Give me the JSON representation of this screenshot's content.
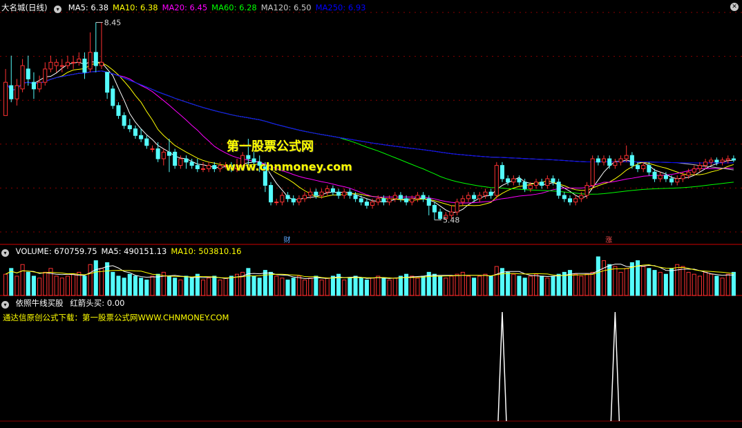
{
  "price_panel": {
    "title": "大名城(日线)",
    "indicators": [
      {
        "label": "MA5: 6.38",
        "color": "#ffffff"
      },
      {
        "label": "MA10: 6.38",
        "color": "#ffff00"
      },
      {
        "label": "MA20: 6.45",
        "color": "#ff00ff"
      },
      {
        "label": "MA60: 6.28",
        "color": "#00ff00"
      },
      {
        "label": "MA120: 6.50",
        "color": "#c8c8c8"
      },
      {
        "label": "MA250: 6.93",
        "color": "#0000ff"
      }
    ],
    "high_label": "8.45",
    "low_label": "5.48",
    "event_markers": [
      "财",
      "涨"
    ]
  },
  "volume_panel": {
    "indicators": [
      {
        "label": "VOLUME: 670759.75",
        "color": "#ffffff"
      },
      {
        "label": "MA5: 490151.13",
        "color": "#ffffff"
      },
      {
        "label": "MA10: 503810.16",
        "color": "#ffff00"
      }
    ]
  },
  "signal_panel": {
    "title": "依照牛线买股",
    "value_label": "红箭头买: 0.00",
    "download_note": "通达信原创公式下载：第一股票公式网WWW.CHNMONEY.COM"
  },
  "watermark": {
    "line1": "第一股票公式网",
    "line2": "www.chnmoney.com"
  },
  "colors": {
    "up": "#ff3232",
    "down": "#54fcfc",
    "grid": "#8b0000",
    "background": "#000000"
  },
  "chart_data": {
    "type": "candlestick",
    "ylim": [
      5.3,
      8.6
    ],
    "candles": [
      [
        7.05,
        7.55,
        7.1,
        7.75
      ],
      [
        7.5,
        7.3,
        7.25,
        7.95
      ],
      [
        7.3,
        7.5,
        7.2,
        7.6
      ],
      [
        7.45,
        7.8,
        7.4,
        7.9
      ],
      [
        7.75,
        7.6,
        7.5,
        7.95
      ],
      [
        7.55,
        7.45,
        7.3,
        7.7
      ],
      [
        7.45,
        7.55,
        7.4,
        7.65
      ],
      [
        7.55,
        7.75,
        7.5,
        7.85
      ],
      [
        7.75,
        7.85,
        7.7,
        7.95
      ],
      [
        7.8,
        7.85,
        7.7,
        7.9
      ],
      [
        7.8,
        7.8,
        7.7,
        7.9
      ],
      [
        7.8,
        7.85,
        7.75,
        7.95
      ],
      [
        7.85,
        7.85,
        7.75,
        7.95
      ],
      [
        7.85,
        7.9,
        7.8,
        8.0
      ],
      [
        7.9,
        7.7,
        7.6,
        8.0
      ],
      [
        7.75,
        8.0,
        7.7,
        8.3
      ],
      [
        8.0,
        7.8,
        7.7,
        8.45
      ],
      [
        7.8,
        7.85,
        7.75,
        8.45
      ],
      [
        7.7,
        7.4,
        7.3,
        7.7
      ],
      [
        7.45,
        7.2,
        7.15,
        7.5
      ],
      [
        7.2,
        7.05,
        7.0,
        7.25
      ],
      [
        7.05,
        6.9,
        6.85,
        7.1
      ],
      [
        6.9,
        6.85,
        6.8,
        7.0
      ],
      [
        6.85,
        6.75,
        6.7,
        6.9
      ],
      [
        6.75,
        6.7,
        6.65,
        6.85
      ],
      [
        6.7,
        6.6,
        6.55,
        6.75
      ],
      [
        6.55,
        6.55,
        6.5,
        6.6
      ],
      [
        6.55,
        6.4,
        6.35,
        6.65
      ],
      [
        6.4,
        6.5,
        6.3,
        6.55
      ],
      [
        6.5,
        6.45,
        6.2,
        6.7
      ],
      [
        6.5,
        6.3,
        6.25,
        6.55
      ],
      [
        6.3,
        6.4,
        6.25,
        6.45
      ],
      [
        6.4,
        6.35,
        6.25,
        6.45
      ],
      [
        6.35,
        6.3,
        6.25,
        6.4
      ],
      [
        6.3,
        6.25,
        6.2,
        6.4
      ],
      [
        6.25,
        6.25,
        6.2,
        6.35
      ],
      [
        6.25,
        6.3,
        6.2,
        6.35
      ],
      [
        6.3,
        6.25,
        6.2,
        6.35
      ],
      [
        6.25,
        6.3,
        6.2,
        6.35
      ],
      [
        6.3,
        6.3,
        6.25,
        6.35
      ],
      [
        6.3,
        6.25,
        6.2,
        6.35
      ],
      [
        6.25,
        6.3,
        6.2,
        6.4
      ],
      [
        6.3,
        6.45,
        6.25,
        6.5
      ],
      [
        6.45,
        6.4,
        6.3,
        6.7
      ],
      [
        6.4,
        6.35,
        6.25,
        6.5
      ],
      [
        6.35,
        6.3,
        6.2,
        6.45
      ],
      [
        6.3,
        6.0,
        5.9,
        6.35
      ],
      [
        6.0,
        5.75,
        5.7,
        6.05
      ],
      [
        5.75,
        5.75,
        5.7,
        5.8
      ],
      [
        5.75,
        5.85,
        5.7,
        5.9
      ],
      [
        5.85,
        5.8,
        5.75,
        5.9
      ],
      [
        5.8,
        5.75,
        5.7,
        5.85
      ],
      [
        5.75,
        5.8,
        5.7,
        5.85
      ],
      [
        5.8,
        5.85,
        5.75,
        5.9
      ],
      [
        5.85,
        5.9,
        5.8,
        5.95
      ],
      [
        5.9,
        5.85,
        5.8,
        5.95
      ],
      [
        5.85,
        5.9,
        5.8,
        5.95
      ],
      [
        5.9,
        5.95,
        5.85,
        6.0
      ],
      [
        5.95,
        5.9,
        5.85,
        6.0
      ],
      [
        5.9,
        5.85,
        5.8,
        5.95
      ],
      [
        5.85,
        5.9,
        5.8,
        5.95
      ],
      [
        5.9,
        5.85,
        5.8,
        5.95
      ],
      [
        5.85,
        5.8,
        5.75,
        5.9
      ],
      [
        5.8,
        5.75,
        5.7,
        5.85
      ],
      [
        5.75,
        5.7,
        5.65,
        5.8
      ],
      [
        5.7,
        5.75,
        5.65,
        5.8
      ],
      [
        5.75,
        5.8,
        5.7,
        5.85
      ],
      [
        5.8,
        5.75,
        5.7,
        5.85
      ],
      [
        5.75,
        5.8,
        5.7,
        5.85
      ],
      [
        5.8,
        5.85,
        5.75,
        5.9
      ],
      [
        5.85,
        5.8,
        5.75,
        5.9
      ],
      [
        5.8,
        5.75,
        5.7,
        5.85
      ],
      [
        5.75,
        5.8,
        5.7,
        5.85
      ],
      [
        5.8,
        5.85,
        5.75,
        5.9
      ],
      [
        5.85,
        5.8,
        5.75,
        5.9
      ],
      [
        5.8,
        5.7,
        5.55,
        5.85
      ],
      [
        5.7,
        5.6,
        5.48,
        5.75
      ],
      [
        5.6,
        5.5,
        5.48,
        5.65
      ],
      [
        5.5,
        5.55,
        5.48,
        5.6
      ],
      [
        5.55,
        5.6,
        5.5,
        5.7
      ],
      [
        5.6,
        5.75,
        5.55,
        5.8
      ],
      [
        5.75,
        5.8,
        5.7,
        5.85
      ],
      [
        5.8,
        5.85,
        5.75,
        5.9
      ],
      [
        5.85,
        5.8,
        5.75,
        5.9
      ],
      [
        5.8,
        5.85,
        5.75,
        5.9
      ],
      [
        5.85,
        5.9,
        5.8,
        5.95
      ],
      [
        5.9,
        5.85,
        5.8,
        5.95
      ],
      [
        5.85,
        6.3,
        5.8,
        6.35
      ],
      [
        6.3,
        6.1,
        6.05,
        6.35
      ],
      [
        6.1,
        6.05,
        6.0,
        6.15
      ],
      [
        6.05,
        6.1,
        6.0,
        6.15
      ],
      [
        6.1,
        6.05,
        6.0,
        6.15
      ],
      [
        6.05,
        5.95,
        5.9,
        6.1
      ],
      [
        5.95,
        6.0,
        5.9,
        6.05
      ],
      [
        6.0,
        6.05,
        5.95,
        6.1
      ],
      [
        6.05,
        6.0,
        5.95,
        6.1
      ],
      [
        6.0,
        6.1,
        5.95,
        6.15
      ],
      [
        6.1,
        6.05,
        6.0,
        6.15
      ],
      [
        6.05,
        5.85,
        5.8,
        6.1
      ],
      [
        5.85,
        5.8,
        5.75,
        5.9
      ],
      [
        5.8,
        5.75,
        5.7,
        5.85
      ],
      [
        5.75,
        5.8,
        5.7,
        5.85
      ],
      [
        5.8,
        5.85,
        5.75,
        5.9
      ],
      [
        5.85,
        6.0,
        5.8,
        6.05
      ],
      [
        6.0,
        6.4,
        5.95,
        6.45
      ],
      [
        6.4,
        6.35,
        6.3,
        6.45
      ],
      [
        6.35,
        6.4,
        6.3,
        6.45
      ],
      [
        6.4,
        6.3,
        6.25,
        6.45
      ],
      [
        6.3,
        6.35,
        6.25,
        6.4
      ],
      [
        6.35,
        6.4,
        6.3,
        6.45
      ],
      [
        6.4,
        6.45,
        6.35,
        6.6
      ],
      [
        6.45,
        6.3,
        6.25,
        6.5
      ],
      [
        6.3,
        6.25,
        6.2,
        6.35
      ],
      [
        6.25,
        6.3,
        6.2,
        6.35
      ],
      [
        6.3,
        6.2,
        6.15,
        6.35
      ],
      [
        6.2,
        6.1,
        6.05,
        6.25
      ],
      [
        6.1,
        6.15,
        6.05,
        6.2
      ],
      [
        6.15,
        6.1,
        6.05,
        6.2
      ],
      [
        6.1,
        6.05,
        6.0,
        6.15
      ],
      [
        6.05,
        6.1,
        6.0,
        6.15
      ],
      [
        6.1,
        6.15,
        6.05,
        6.2
      ],
      [
        6.15,
        6.2,
        6.1,
        6.25
      ],
      [
        6.2,
        6.25,
        6.15,
        6.3
      ],
      [
        6.25,
        6.3,
        6.2,
        6.35
      ],
      [
        6.3,
        6.35,
        6.25,
        6.4
      ],
      [
        6.35,
        6.38,
        6.3,
        6.42
      ],
      [
        6.38,
        6.35,
        6.3,
        6.42
      ],
      [
        6.35,
        6.38,
        6.3,
        6.42
      ],
      [
        6.38,
        6.4,
        6.33,
        6.45
      ],
      [
        6.4,
        6.38,
        6.35,
        6.45
      ]
    ],
    "volume": [
      0.55,
      0.7,
      0.5,
      0.8,
      0.6,
      0.5,
      0.45,
      0.6,
      0.7,
      0.5,
      0.45,
      0.5,
      0.55,
      0.6,
      0.5,
      0.8,
      0.9,
      0.7,
      0.85,
      0.6,
      0.5,
      0.45,
      0.55,
      0.5,
      0.45,
      0.4,
      0.5,
      0.55,
      0.6,
      0.5,
      0.45,
      0.4,
      0.5,
      0.45,
      0.55,
      0.4,
      0.45,
      0.5,
      0.4,
      0.45,
      0.5,
      0.55,
      0.6,
      0.7,
      0.5,
      0.45,
      0.65,
      0.6,
      0.5,
      0.45,
      0.4,
      0.45,
      0.5,
      0.4,
      0.45,
      0.5,
      0.4,
      0.45,
      0.5,
      0.55,
      0.4,
      0.45,
      0.5,
      0.45,
      0.4,
      0.45,
      0.5,
      0.45,
      0.4,
      0.45,
      0.5,
      0.55,
      0.5,
      0.45,
      0.5,
      0.6,
      0.55,
      0.5,
      0.45,
      0.5,
      0.55,
      0.6,
      0.5,
      0.45,
      0.5,
      0.55,
      0.5,
      0.75,
      0.7,
      0.6,
      0.55,
      0.5,
      0.45,
      0.5,
      0.55,
      0.5,
      0.45,
      0.5,
      0.55,
      0.6,
      0.65,
      0.55,
      0.5,
      0.55,
      0.6,
      1.0,
      0.9,
      0.8,
      0.75,
      0.6,
      0.7,
      0.85,
      0.9,
      0.75,
      0.7,
      0.65,
      0.6,
      0.55,
      0.7,
      0.8,
      0.75,
      0.6,
      0.55,
      0.5,
      0.6,
      0.55,
      0.5,
      0.45,
      0.55,
      0.6
    ],
    "signal_peaks": [
      88,
      108
    ]
  }
}
